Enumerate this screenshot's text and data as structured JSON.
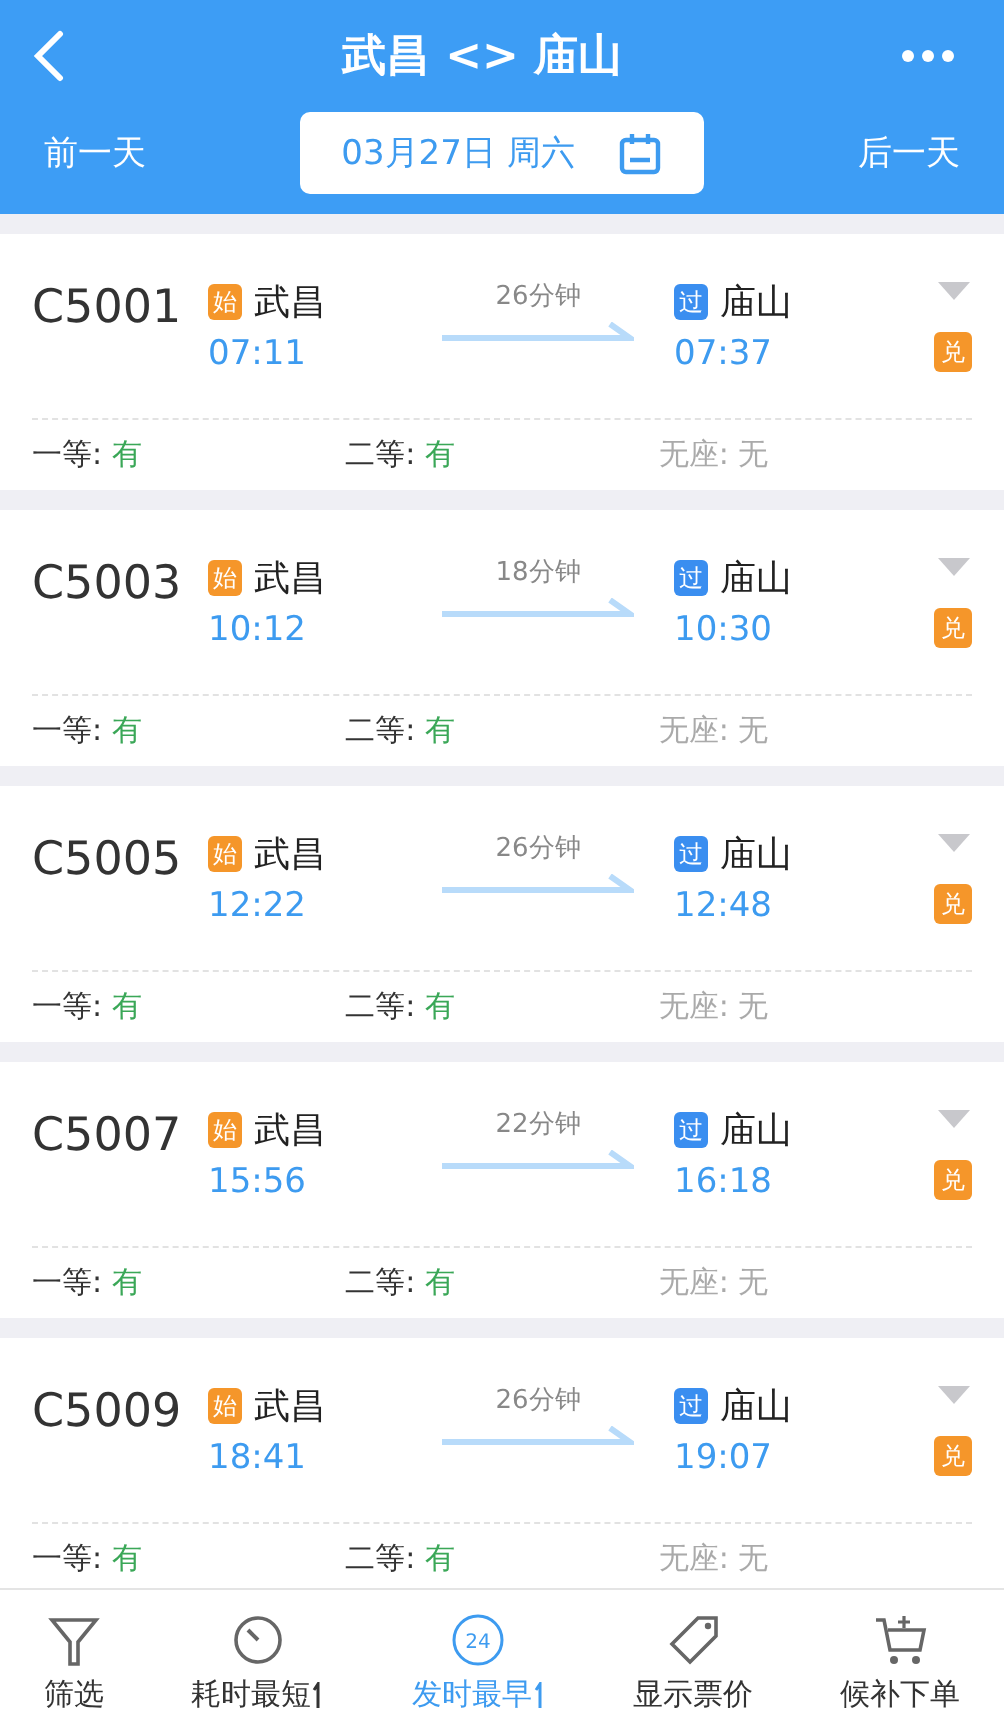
{
  "header": {
    "title": "武昌 <> 庙山",
    "prev_day": "前一天",
    "date": "03月27日 周六",
    "next_day": "后一天"
  },
  "trains": [
    {
      "code": "C5001",
      "from_tag": "始",
      "from": "武昌",
      "depart": "07:11",
      "duration": "26分钟",
      "to_tag": "过",
      "to": "庙山",
      "arrive": "07:37",
      "exchange": "兑",
      "seats": [
        {
          "label": "一等:",
          "value": "有",
          "available": true
        },
        {
          "label": "二等:",
          "value": "有",
          "available": true
        },
        {
          "label": "无座:",
          "value": "无",
          "available": false
        }
      ]
    },
    {
      "code": "C5003",
      "from_tag": "始",
      "from": "武昌",
      "depart": "10:12",
      "duration": "18分钟",
      "to_tag": "过",
      "to": "庙山",
      "arrive": "10:30",
      "exchange": "兑",
      "seats": [
        {
          "label": "一等:",
          "value": "有",
          "available": true
        },
        {
          "label": "二等:",
          "value": "有",
          "available": true
        },
        {
          "label": "无座:",
          "value": "无",
          "available": false
        }
      ]
    },
    {
      "code": "C5005",
      "from_tag": "始",
      "from": "武昌",
      "depart": "12:22",
      "duration": "26分钟",
      "to_tag": "过",
      "to": "庙山",
      "arrive": "12:48",
      "exchange": "兑",
      "seats": [
        {
          "label": "一等:",
          "value": "有",
          "available": true
        },
        {
          "label": "二等:",
          "value": "有",
          "available": true
        },
        {
          "label": "无座:",
          "value": "无",
          "available": false
        }
      ]
    },
    {
      "code": "C5007",
      "from_tag": "始",
      "from": "武昌",
      "depart": "15:56",
      "duration": "22分钟",
      "to_tag": "过",
      "to": "庙山",
      "arrive": "16:18",
      "exchange": "兑",
      "seats": [
        {
          "label": "一等:",
          "value": "有",
          "available": true
        },
        {
          "label": "二等:",
          "value": "有",
          "available": true
        },
        {
          "label": "无座:",
          "value": "无",
          "available": false
        }
      ]
    },
    {
      "code": "C5009",
      "from_tag": "始",
      "from": "武昌",
      "depart": "18:41",
      "duration": "26分钟",
      "to_tag": "过",
      "to": "庙山",
      "arrive": "19:07",
      "exchange": "兑",
      "seats": [
        {
          "label": "一等:",
          "value": "有",
          "available": true
        },
        {
          "label": "二等:",
          "value": "有",
          "available": true
        },
        {
          "label": "无座:",
          "value": "无",
          "available": false
        }
      ]
    }
  ],
  "toolbar": [
    {
      "kind": "filter",
      "label": "筛选",
      "selected": false,
      "sort": false
    },
    {
      "kind": "timer",
      "label": "耗时最短",
      "selected": false,
      "sort": true
    },
    {
      "kind": "clock",
      "label": "发时最早",
      "selected": true,
      "sort": true,
      "badge": "24"
    },
    {
      "kind": "tag",
      "label": "显示票价",
      "selected": false,
      "sort": false
    },
    {
      "kind": "cart",
      "label": "候补下单",
      "selected": false,
      "sort": false
    }
  ]
}
